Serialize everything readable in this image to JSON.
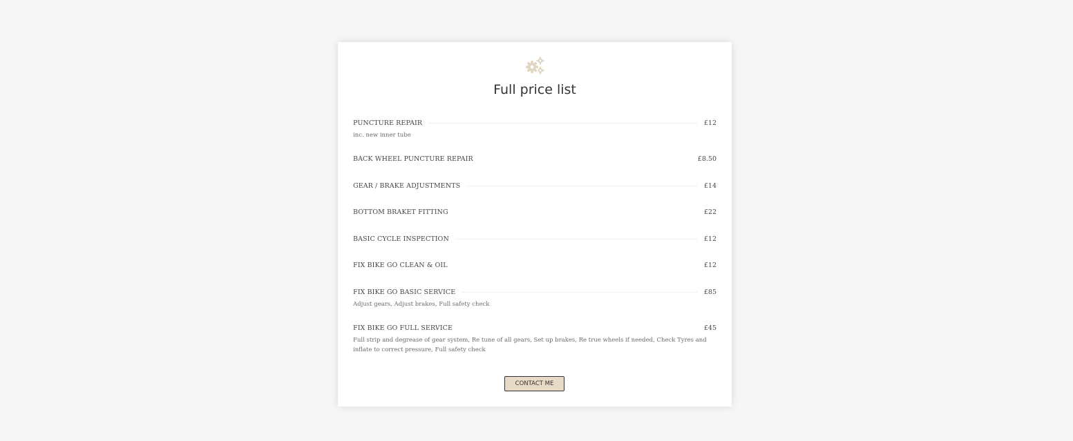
{
  "header": {
    "icon": "gears-icon",
    "icon_color": "#e0d5c2",
    "title": "Full price list"
  },
  "price_list": [
    {
      "name": "PUNCTURE REPAIR",
      "price": "£12",
      "description": "inc. new inner tube",
      "leader": true
    },
    {
      "name": "BACK WHEEL PUNCTURE REPAIR",
      "price": "£8.50",
      "description": "",
      "leader": false
    },
    {
      "name": "GEAR / BRAKE ADJUSTMENTS",
      "price": "£14",
      "description": "",
      "leader": true
    },
    {
      "name": "BOTTOM BRAKET FITTING",
      "price": "£22",
      "description": "",
      "leader": false
    },
    {
      "name": "BASIC CYCLE INSPECTION",
      "price": "£12",
      "description": "",
      "leader": true
    },
    {
      "name": "FIX BIKE GO CLEAN & OIL",
      "price": "£12",
      "description": "",
      "leader": false
    },
    {
      "name": "FIX BIKE GO BASIC SERVICE",
      "price": "£85",
      "description": "Adjust gears, Adjust brakes, Full safety check",
      "leader": true
    },
    {
      "name": "FIX BIKE GO FULL SERVICE",
      "price": "£45",
      "description": "Full strip and degrease of gear system, Re tune of all gears, Set up brakes, Re true wheels if needed, Check Tyres and inflate to correct pressure, Full safety check",
      "leader": false
    }
  ],
  "contact_button": {
    "label": "CONTACT ME",
    "color": "#e8dac6"
  }
}
